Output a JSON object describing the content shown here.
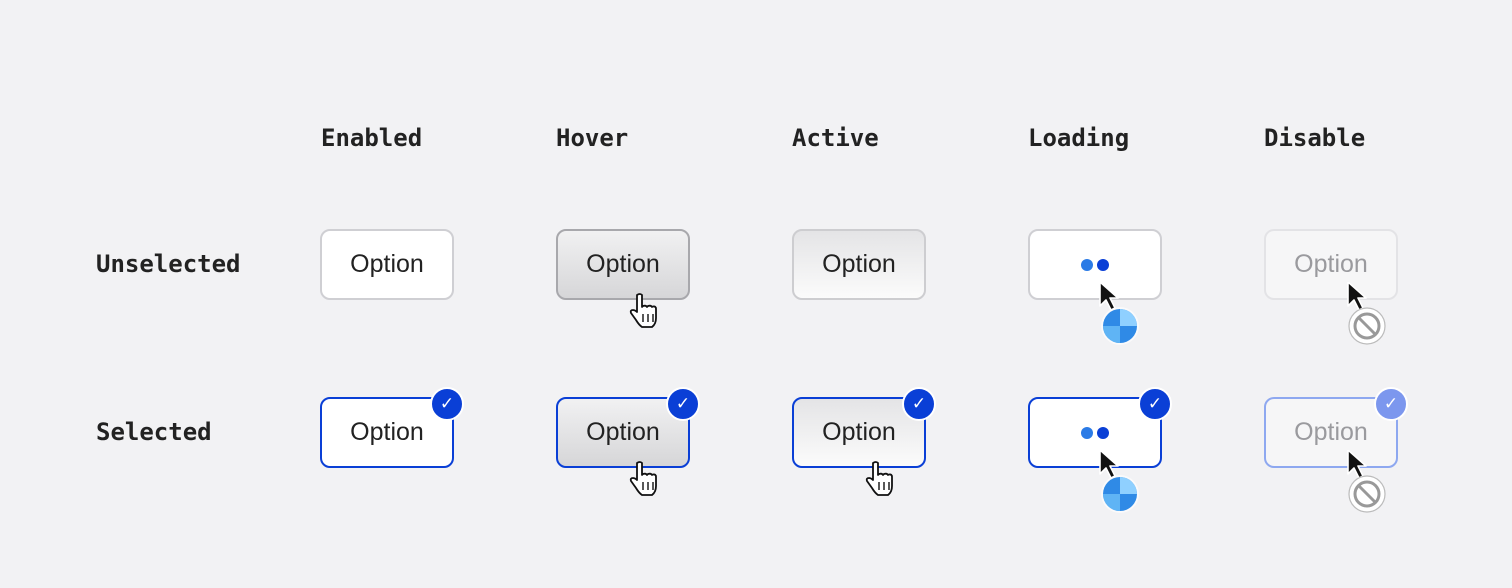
{
  "columns": [
    "Enabled",
    "Hover",
    "Active",
    "Loading",
    "Disable"
  ],
  "rows": [
    "Unselected",
    "Selected"
  ],
  "option_label": "Option",
  "colors": {
    "selected_border": "#0a3fd6",
    "check_badge": "#0a3fd6",
    "check_badge_disabled": "#7c97ee",
    "loading_dot_light": "#2b7be6",
    "loading_dot_dark": "#0a3fd6"
  },
  "icons": {
    "hover_cursor": "hand-pointer-icon",
    "loading_cursor": "arrow-busy-spinner-icon",
    "disabled_cursor": "arrow-not-allowed-icon",
    "selected_badge": "checkmark-icon"
  }
}
